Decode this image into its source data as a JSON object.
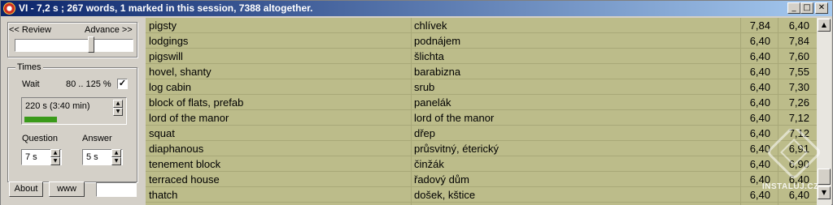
{
  "titlebar": {
    "title": "VI - 7,2 s ; 267 words, 1 marked in this session, 7388 altogether.",
    "minimize_label": "_",
    "maximize_label": "□",
    "close_label": "✕"
  },
  "review": {
    "review_label": "<< Review",
    "advance_label": "Advance >>",
    "slider_position": 0.65
  },
  "times": {
    "group_label": "Times",
    "wait_label": "Wait",
    "range_label": "80 .. 125 %",
    "range_checked": true,
    "check_mark": "✓",
    "wait_value": "220 s (3:40 min)",
    "progress": 0.33,
    "question_label": "Question",
    "answer_label": "Answer",
    "question_value": "7 s",
    "answer_value": "5 s"
  },
  "buttons": {
    "about_label": "About",
    "www_label": "www"
  },
  "spin_icons": {
    "up": "▲",
    "down": "▼"
  },
  "scroll_icons": {
    "up": "▲",
    "down": "▼"
  },
  "words": [
    {
      "en": "pigsty",
      "cz": "chlívek",
      "n1": "7,84",
      "n2": "6,40"
    },
    {
      "en": "lodgings",
      "cz": "podnájem",
      "n1": "6,40",
      "n2": "7,84"
    },
    {
      "en": "pigswill",
      "cz": "šlichta",
      "n1": "6,40",
      "n2": "7,60"
    },
    {
      "en": "hovel, shanty",
      "cz": "barabizna",
      "n1": "6,40",
      "n2": "7,55"
    },
    {
      "en": "log cabin",
      "cz": "srub",
      "n1": "6,40",
      "n2": "7,30"
    },
    {
      "en": "block of flats, prefab",
      "cz": "panelák",
      "n1": "6,40",
      "n2": "7,26"
    },
    {
      "en": "lord of the manor",
      "cz": "lord of the manor",
      "n1": "6,40",
      "n2": "7,12"
    },
    {
      "en": "squat",
      "cz": "dřep",
      "n1": "6,40",
      "n2": "7,12"
    },
    {
      "en": "diaphanous",
      "cz": "průsvitný, éterický",
      "n1": "6,40",
      "n2": "6,91"
    },
    {
      "en": "tenement block",
      "cz": "činžák",
      "n1": "6,40",
      "n2": "6,90"
    },
    {
      "en": "terraced house",
      "cz": "řadový dům",
      "n1": "6,40",
      "n2": "6,40"
    },
    {
      "en": "thatch",
      "cz": "došek, kštice",
      "n1": "6,40",
      "n2": "6,40"
    }
  ],
  "watermark": {
    "text": "INSTALUJ.CZ"
  },
  "colors": {
    "list_bg": "#bcbc8a",
    "progress": "#3a9a1a",
    "titlebar": "#0a246a"
  }
}
